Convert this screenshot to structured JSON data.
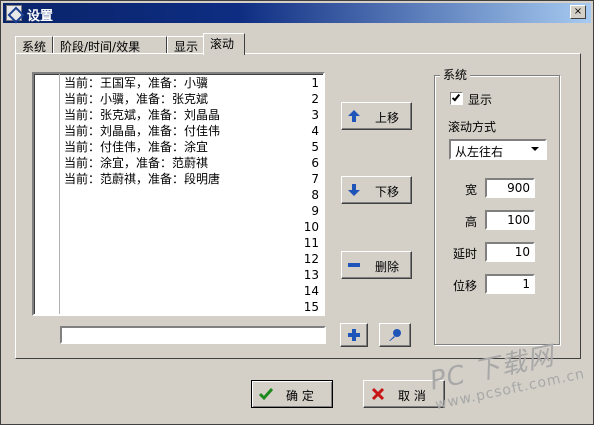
{
  "window": {
    "title": "设置",
    "close_label": "×"
  },
  "tabs": [
    {
      "label": "系统",
      "active": false
    },
    {
      "label": "阶段/时间/效果",
      "active": false
    },
    {
      "label": "显示",
      "active": false
    },
    {
      "label": "滚动",
      "active": true
    }
  ],
  "list": {
    "line_numbers": [
      "1",
      "2",
      "3",
      "4",
      "5",
      "6",
      "7",
      "8",
      "9",
      "10",
      "11",
      "12",
      "13",
      "14",
      "15"
    ],
    "lines": [
      "当前：王国军，准备：小骥",
      "当前：小骥，准备：张克斌",
      "当前：张克斌，准备：刘晶晶",
      "当前：刘晶晶，准备：付佳伟",
      "当前：付佳伟，准备：涂宜",
      "当前：涂宜，准备：范蔚祺",
      "当前：范蔚祺，准备：段明唐"
    ]
  },
  "input": {
    "value": ""
  },
  "actions": {
    "up_label": "上移",
    "up_icon": "arrow-up-icon",
    "down_label": "下移",
    "down_icon": "arrow-down-icon",
    "delete_label": "删除",
    "delete_icon": "minus-icon",
    "add_icon": "plus-icon",
    "edit_icon": "pen-icon"
  },
  "system": {
    "group_title": "系统",
    "show_checked": true,
    "show_label": "显示",
    "scroll_mode_label": "滚动方式",
    "scroll_mode_value": "从左往右",
    "width_label": "宽",
    "width_value": "900",
    "height_label": "高",
    "height_value": "100",
    "delay_label": "延时",
    "delay_value": "10",
    "offset_label": "位移",
    "offset_value": "1"
  },
  "footer": {
    "ok_label": "确 定",
    "ok_icon": "check-icon",
    "cancel_label": "取 消",
    "cancel_icon": "x-icon"
  },
  "watermark": {
    "big": "PC 下载网",
    "small": "www.pcsoft.com.cn"
  },
  "colors": {
    "accent": "#0a246a",
    "icon_blue": "#1f55b8",
    "ok_green": "#1c8a1c",
    "cancel_red": "#c81414"
  }
}
